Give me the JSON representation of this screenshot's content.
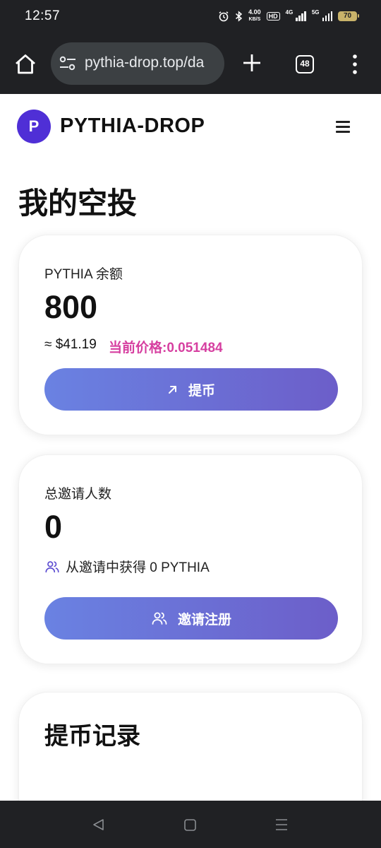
{
  "status_bar": {
    "time": "12:57",
    "speed_value": "4.00",
    "speed_unit": "KB/S",
    "hd_label": "HD",
    "network_1": "4G",
    "network_2": "5G",
    "battery": "70",
    "icons": [
      "alarm-icon",
      "bluetooth-icon",
      "signal-icon",
      "battery-icon"
    ]
  },
  "browser": {
    "url": "pythia-drop.top/da",
    "tab_count": "48",
    "icons": [
      "home-icon",
      "tune-icon",
      "plus-icon",
      "tabs-icon",
      "more-vert-icon"
    ]
  },
  "site": {
    "logo_letter": "P",
    "brand": "PYTHIA-DROP",
    "menu_icon": "hamburger-icon",
    "logo_color": "#4f2fd6"
  },
  "page": {
    "title": "我的空投"
  },
  "balance_card": {
    "label": "PYTHIA 余额",
    "value": "800",
    "usd": "≈ $41.19",
    "price": "当前价格:0.051484",
    "price_color": "#d63fa0",
    "button_label": "提币",
    "button_icon": "arrow-up-right-icon"
  },
  "invite_card": {
    "label": "总邀请人数",
    "value": "0",
    "note": "从邀请中获得 0 PYTHIA",
    "note_icon": "users-icon",
    "button_label": "邀请注册",
    "button_icon": "users-icon"
  },
  "withdraw_card": {
    "title": "提币记录"
  },
  "nav_bar": {
    "icons": [
      "back-icon",
      "home-square-icon",
      "recents-icon"
    ]
  },
  "colors": {
    "button_gradient_start": "#6a82e2",
    "button_gradient_end": "#6c5ec9",
    "system_bar": "#202124"
  }
}
